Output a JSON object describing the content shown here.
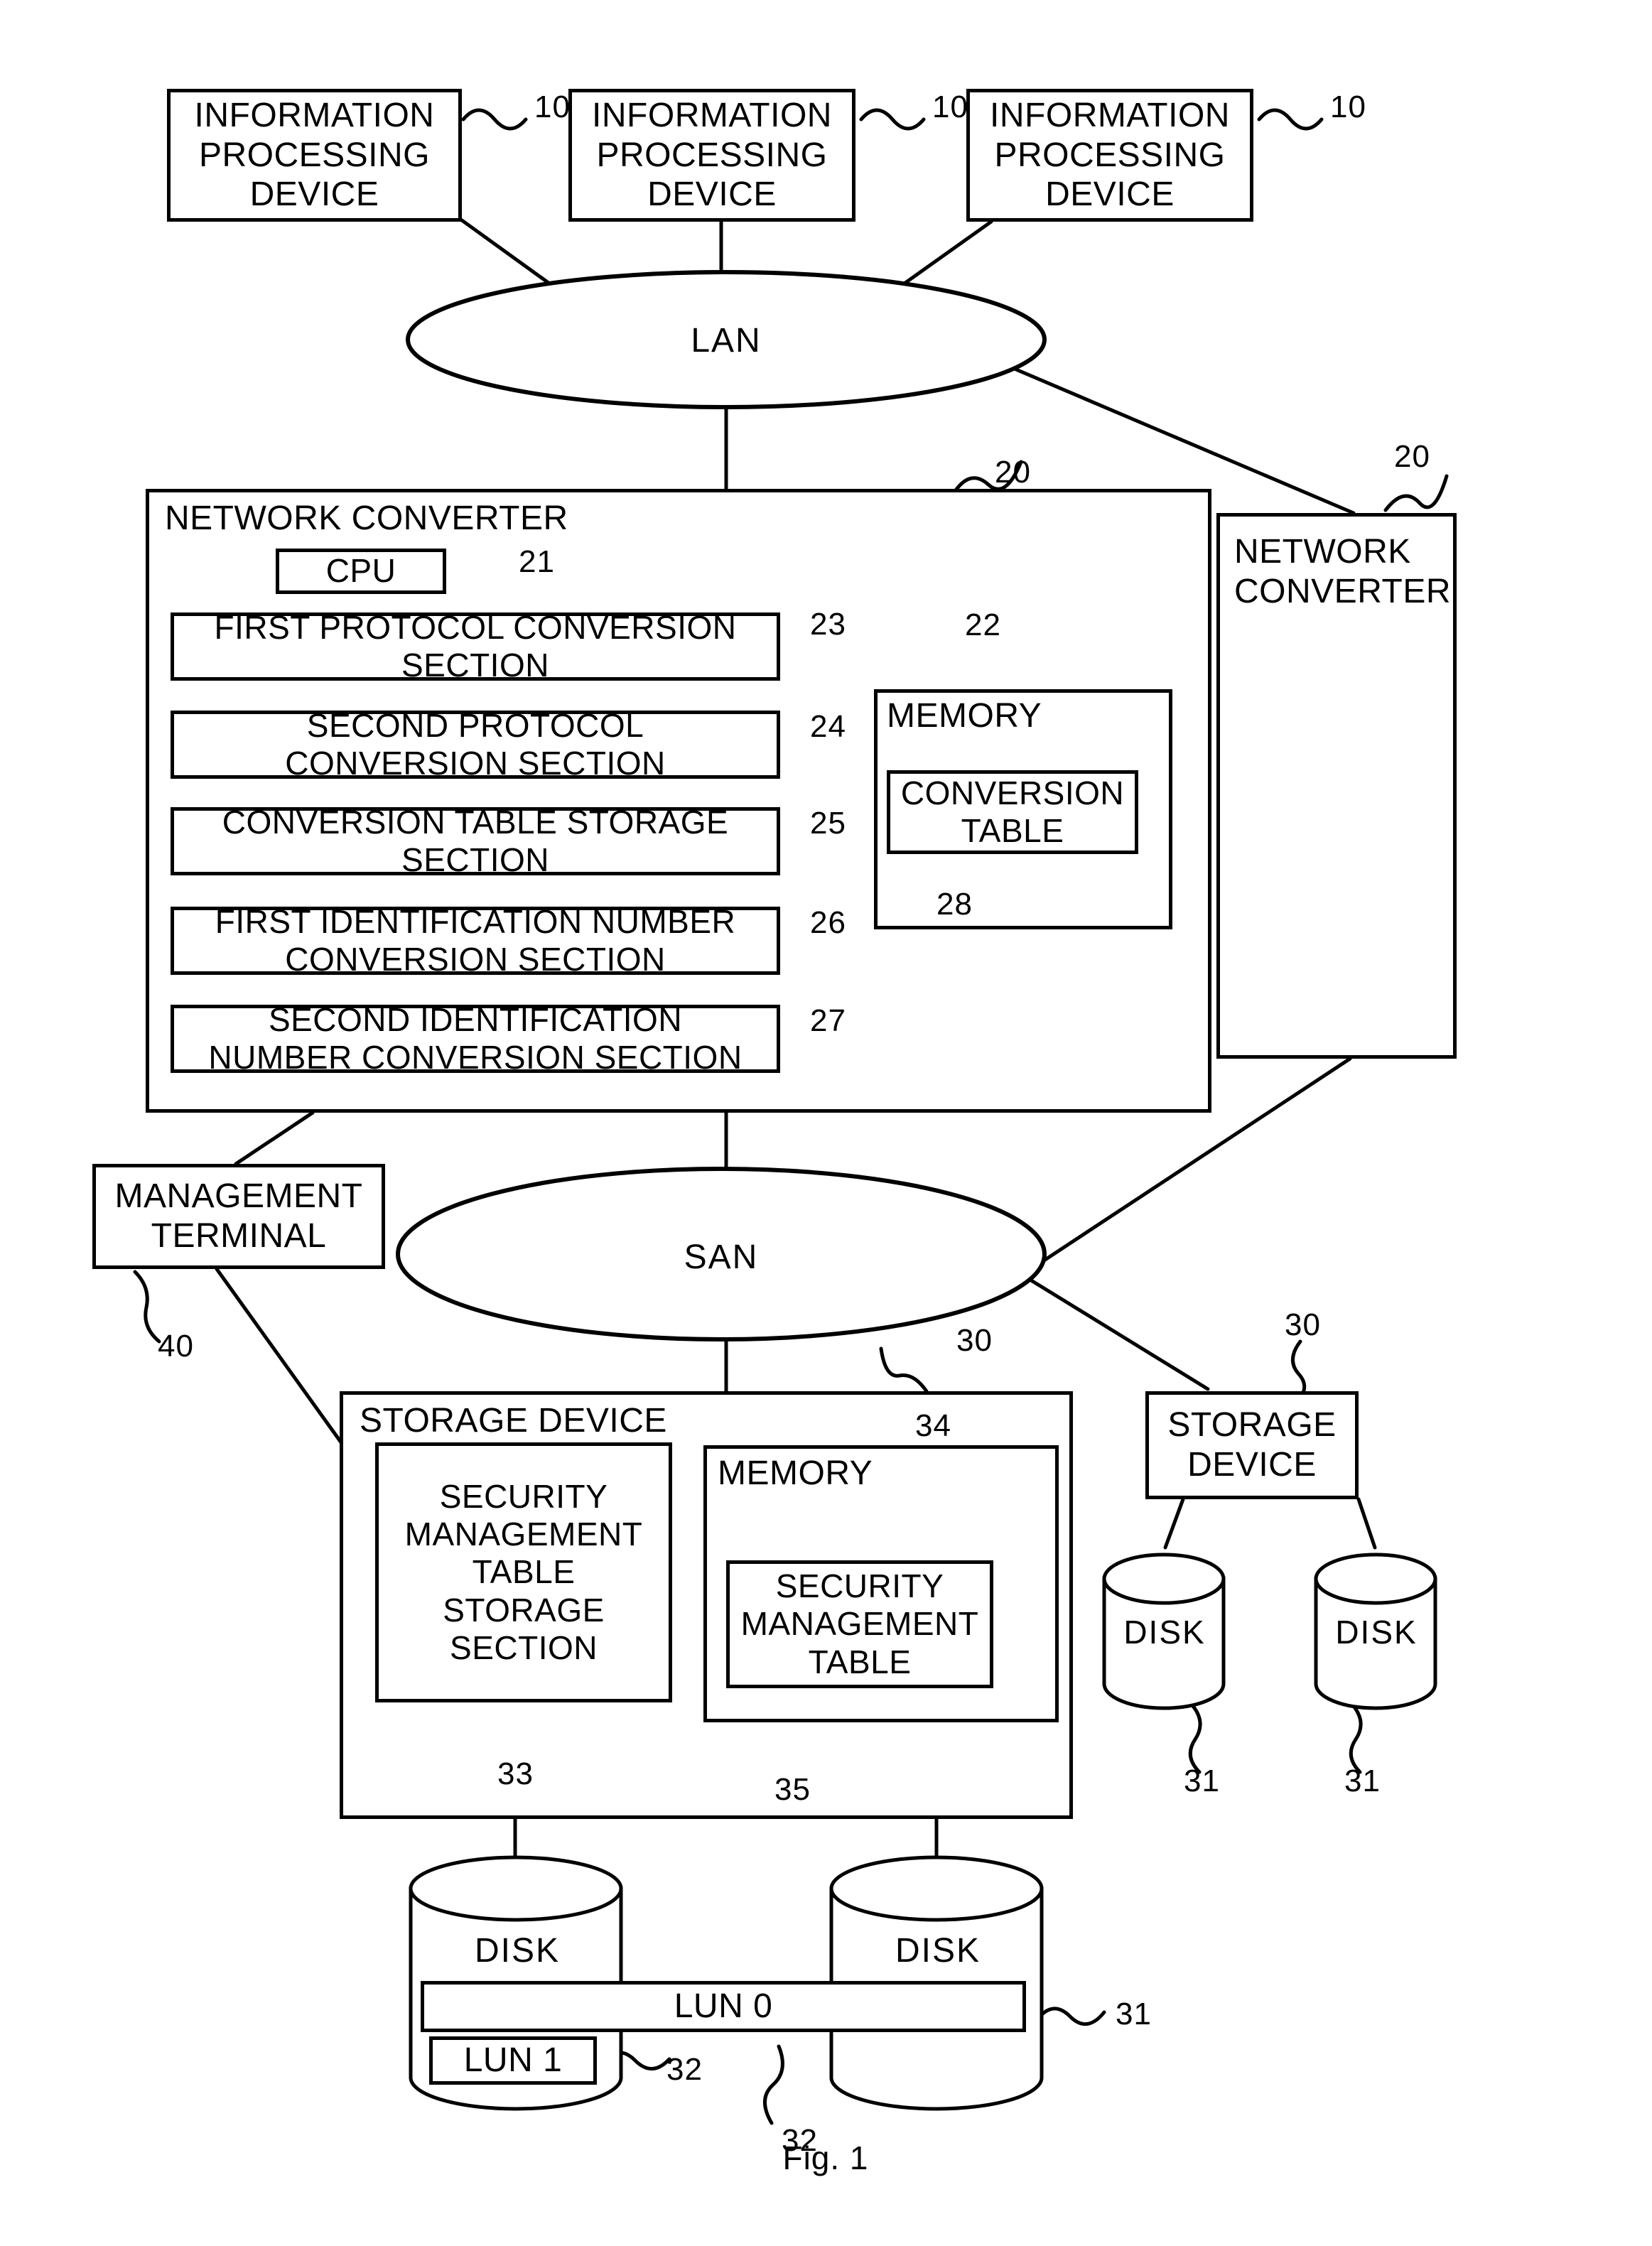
{
  "figure": {
    "caption": "Fig. 1"
  },
  "nodes": {
    "ipd1": {
      "label": "INFORMATION\nPROCESSING\nDEVICE",
      "ref": "10"
    },
    "ipd2": {
      "label": "INFORMATION\nPROCESSING\nDEVICE",
      "ref": "10"
    },
    "ipd3": {
      "label": "INFORMATION\nPROCESSING\nDEVICE",
      "ref": "10"
    },
    "lan": {
      "label": "LAN"
    },
    "san": {
      "label": "SAN"
    },
    "network_converter_main": {
      "label": "NETWORK CONVERTER",
      "ref": "20",
      "cpu": {
        "label": "CPU",
        "ref": "21"
      },
      "sections": [
        {
          "label": "FIRST PROTOCOL CONVERSION\nSECTION",
          "ref": "23"
        },
        {
          "label": "SECOND PROTOCOL\nCONVERSION SECTION",
          "ref": "24"
        },
        {
          "label": "CONVERSION TABLE STORAGE\nSECTION",
          "ref": "25"
        },
        {
          "label": "FIRST IDENTIFICATION NUMBER\nCONVERSION SECTION",
          "ref": "26"
        },
        {
          "label": "SECOND IDENTIFICATION\nNUMBER CONVERSION SECTION",
          "ref": "27"
        }
      ],
      "memory": {
        "label": "MEMORY",
        "ref": "22",
        "table": {
          "label": "CONVERSION\nTABLE",
          "ref": "28"
        }
      }
    },
    "network_converter_right": {
      "label": "NETWORK\nCONVERTER",
      "ref": "20"
    },
    "management_terminal": {
      "label": "MANAGEMENT\nTERMINAL",
      "ref": "40"
    },
    "storage_device_main": {
      "label": "STORAGE DEVICE",
      "ref": "30",
      "security_section": {
        "label": "SECURITY\nMANAGEMENT\nTABLE\nSTORAGE\nSECTION",
        "ref": "33"
      },
      "memory": {
        "label": "MEMORY",
        "ref": "34",
        "table": {
          "label": "SECURITY\nMANAGEMENT\nTABLE",
          "ref": "35"
        }
      },
      "disks": [
        {
          "label": "DISK",
          "ref": "31"
        },
        {
          "label": "DISK",
          "ref": "31"
        }
      ],
      "luns": [
        {
          "label": "LUN  0",
          "ref": "32"
        },
        {
          "label": "LUN  1",
          "ref": "32"
        }
      ]
    },
    "storage_device_right": {
      "label": "STORAGE\nDEVICE",
      "ref": "30",
      "disks": [
        {
          "label": "DISK",
          "ref": "31"
        },
        {
          "label": "DISK",
          "ref": "31"
        }
      ]
    }
  },
  "colors": {
    "stroke": "#000000",
    "background": "#ffffff"
  }
}
